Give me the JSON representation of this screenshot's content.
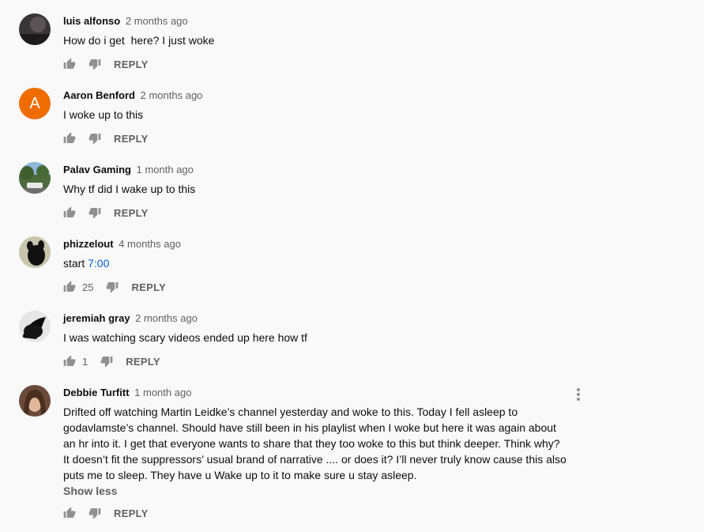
{
  "comments": [
    {
      "author": "luis alfonso",
      "time": "2 months ago",
      "text": "How do i get  here? I just woke",
      "likes": "",
      "avatar_letter": ""
    },
    {
      "author": "Aaron Benford",
      "time": "2 months ago",
      "text": "I woke up to this",
      "likes": "",
      "avatar_letter": "A"
    },
    {
      "author": "Palav Gaming",
      "time": "1 month ago",
      "text": "Why tf did I wake up to this",
      "likes": "",
      "avatar_letter": ""
    },
    {
      "author": "phizzelout",
      "time": "4 months ago",
      "text_prefix": "start ",
      "timestamp_link": "7:00",
      "likes": "25",
      "avatar_letter": ""
    },
    {
      "author": "jeremiah gray",
      "time": "2 months ago",
      "text": "I was watching scary videos ended up here how tf",
      "likes": "1",
      "avatar_letter": ""
    },
    {
      "author": "Debbie Turfitt",
      "time": "1 month ago",
      "text": "Drifted off watching Martin Leidke’s channel yesterday and woke to this. Today I fell asleep to godavlamste’s channel. Should have still been in his playlist when I woke but here it was again about an hr into it. I get that everyone wants to share that they too woke to this but think deeper. Think why? It doesn’t fit the suppressors’ usual brand of narrative .... or does it? I’ll never truly know cause this also puts me to sleep. They have u Wake up to it to make sure u stay asleep.",
      "likes": "",
      "avatar_letter": "",
      "show_less": "Show less"
    }
  ],
  "labels": {
    "reply": "REPLY"
  },
  "icons": {
    "like": "thumb-up-icon",
    "dislike": "thumb-down-icon",
    "menu": "more-vert-icon"
  },
  "colors": {
    "link": "#065fd4",
    "avatar_orange": "#ef6c00",
    "secondary_text": "#606060"
  }
}
